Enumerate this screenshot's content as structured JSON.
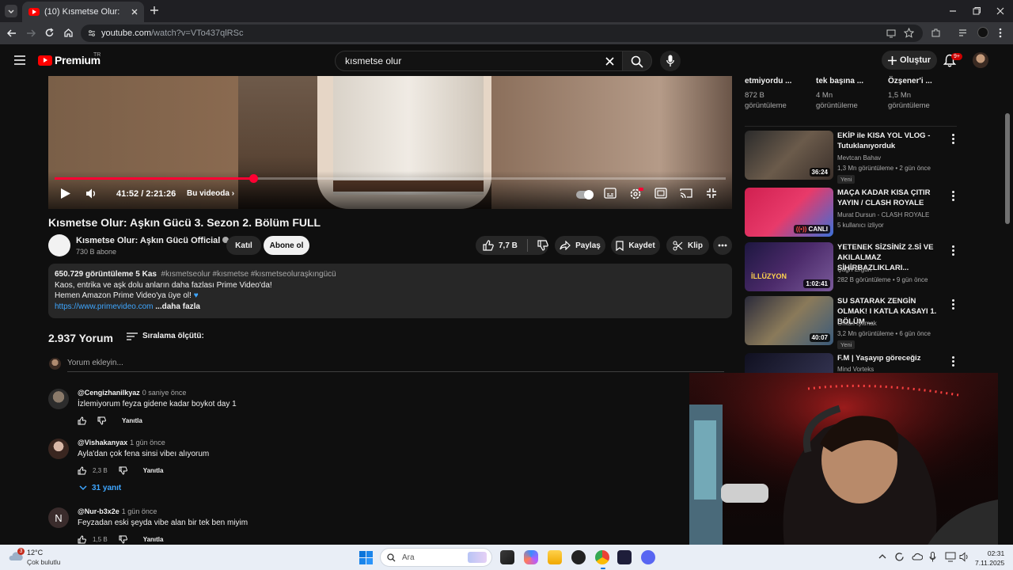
{
  "browser": {
    "tab_title": "(10) Kısmetse Olur: Aşkın Gücü 3",
    "url_host": "youtube.com",
    "url_path": "/watch?v=VTo437qlRSc"
  },
  "header": {
    "logo_text": "Premium",
    "logo_tr": "TR",
    "search_value": "kısmetse olur",
    "create_label": "Oluştur",
    "notif_count": "9+"
  },
  "player": {
    "time": "41:52 / 2:21:26",
    "chapter_label": "Bu videoda",
    "progress": 0.296
  },
  "video": {
    "title": "Kısmetse Olur: Aşkın Gücü 3. Sezon 2. Bölüm FULL",
    "channel": "Kısmetse Olur: Aşkın Gücü Official",
    "subscribers": "730 B abone",
    "join_label": "Katıl",
    "subscribe_label": "Abone ol",
    "likes": "7,7 B",
    "share_label": "Paylaş",
    "save_label": "Kaydet",
    "clip_label": "Klip"
  },
  "description": {
    "meta": "650.729 görüntüleme  5 Kas",
    "tags": "#kısmetseolur #kısmetse #kısmetseoluraşkıngücü",
    "line1": "Kaos, entrika ve aşk dolu anların daha fazlası Prime Video'da!",
    "line2": "Hemen Amazon Prime Video'ya üye ol!",
    "link": "https://www.primevideo.com",
    "more": "...daha fazla"
  },
  "comments": {
    "count": "2.937 Yorum",
    "sort_label": "Sıralama ölçütü:",
    "add_placeholder": "Yorum ekleyin...",
    "reply_label": "Yanıtla",
    "replies_label": "31 yanıt",
    "items": [
      {
        "author": "@Cengizhanilkyaz",
        "when": "0 saniye önce",
        "text": "İzlemiyorum feyza gidene kadar boykot day 1",
        "likes": ""
      },
      {
        "author": "@Vishakanyax",
        "when": "1 gün önce",
        "text": "Ayla'dan çok fena sinsi vibeı alıyorum",
        "likes": "2,3 B"
      },
      {
        "author": "@Nur-b3x2e",
        "when": "1 gün önce",
        "text": "Feyzadan eski şeyda vibe alan bir tek ben miyim",
        "likes": "1,5 B",
        "initial": "N"
      }
    ]
  },
  "sidebar": {
    "top_items": [
      {
        "title": "etmiyordu ...",
        "views": "872 B",
        "label": "görüntüleme"
      },
      {
        "title": "tek başına ...",
        "views": "4 Mn",
        "label": "görüntüleme"
      },
      {
        "title": "Özşener'i ...",
        "views": "1,5 Mn",
        "label": "görüntüleme"
      }
    ],
    "items": [
      {
        "title": "EKİP ile KISA YOL VLOG - Tutuklanıyorduk",
        "channel": "Mevtcan Bahav",
        "meta": "1,3 Mn görüntüleme • 2 gün önce",
        "badge": "Yeni",
        "duration": "36:24"
      },
      {
        "title": "MAÇA KADAR KISA ÇITIR YAYIN / CLASH ROYALE",
        "channel": "Murat Dursun - CLASH ROYALE",
        "meta": "5 kullanıcı izliyor",
        "live": "CANLI"
      },
      {
        "title": "YETENEK SİZSİNİZ 2.Sİ VE AKILALMAZ SİHİRBAZLIKLARI...",
        "channel": "Çağrı Ergün",
        "meta": "282 B görüntüleme • 9 gün önce",
        "duration": "1:02:41",
        "thumb_text": "İLLÜZYON"
      },
      {
        "title": "SU SATARAK ZENGİN OLMAK! I KATLA KASAYI 1. BÖLÜM ...",
        "channel": "Orkun Işıtmak",
        "meta": "3,2 Mn görüntüleme • 6 gün önce",
        "badge": "Yeni",
        "duration": "40:07"
      },
      {
        "title": "F.M | Yaşayıp göreceğiz",
        "channel": "Mind Vorteks"
      }
    ]
  },
  "taskbar": {
    "temp": "12°C",
    "weather": "Çok bulutlu",
    "weather_badge": "3",
    "search_label": "Ara",
    "time": "02:31",
    "date": "7.11.2025"
  },
  "colors": {
    "accent_red": "#ff0033",
    "link_blue": "#3ea6ff",
    "background": "#0f0f0f"
  }
}
